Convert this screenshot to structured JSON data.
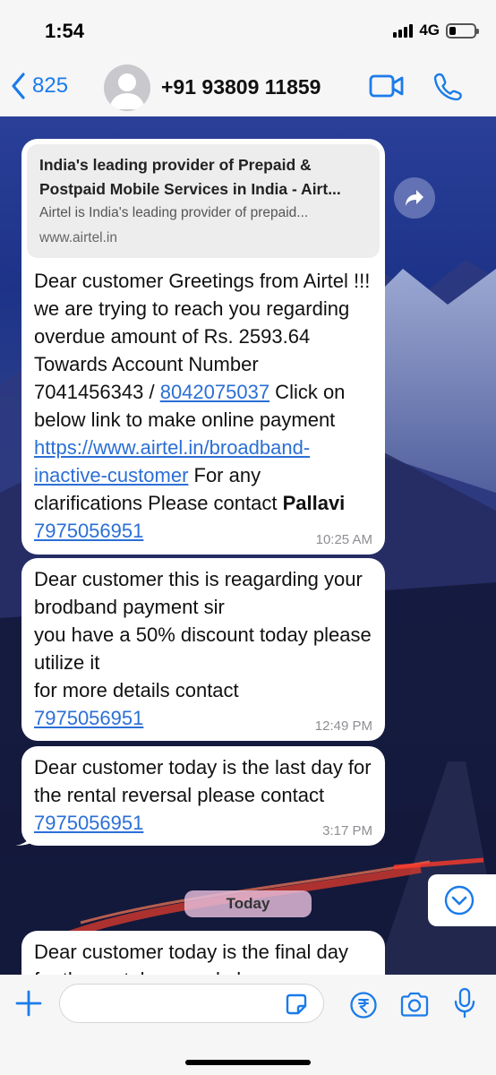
{
  "status_bar": {
    "time": "1:54",
    "network": "4G"
  },
  "header": {
    "back_count": "825",
    "contact_name": "+91 93809 11859"
  },
  "messages": [
    {
      "preview": {
        "title": "India's leading provider of Prepaid & Postpaid Mobile Services in India - Airt...",
        "description": "Airtel is India's leading provider of prepaid...",
        "domain": "www.airtel.in"
      },
      "text_1": "Dear customer Greetings from Airtel !!!  we are trying to reach you regarding overdue amount of Rs. 2593.64 Towards Account Number 7041456343 / ",
      "link_1": "8042075037",
      "text_2": " Click on below link to make online payment ",
      "link_2": "https://www.airtel.in/broadband-inactive-customer",
      "text_3": "  For any clarifications Please contact ",
      "bold_name": "Pallavi",
      "link_3": "7975056951",
      "time": "10:25 AM"
    },
    {
      "text": "Dear customer this is reagarding your brodband payment sir\nyou have a 50% discount today please utilize it\nfor more details contact\n",
      "link": "7975056951",
      "time": "12:49 PM"
    },
    {
      "text": "Dear customer today is the last day for the rental reversal please contact ",
      "link": "7975056951",
      "time": "3:17 PM"
    },
    {
      "text": "Dear customer today is the final day for the rental reversal please"
    }
  ],
  "date_separator": "Today",
  "input": {
    "placeholder": ""
  }
}
